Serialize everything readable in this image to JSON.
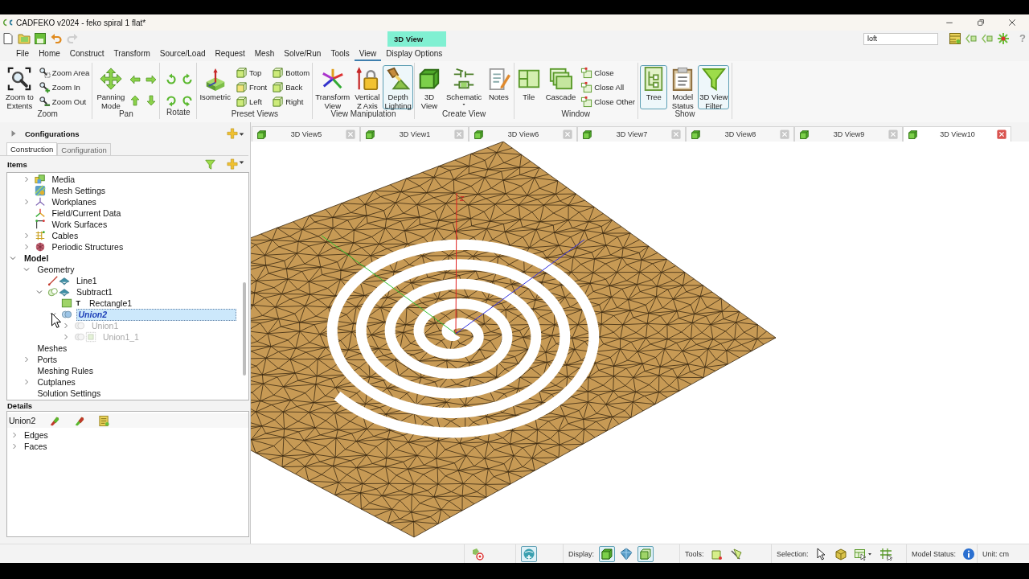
{
  "window": {
    "title": "CADFEKO v2024 - feko spiral 1 flat*",
    "context_tab": "3D View",
    "search": {
      "value": "loft"
    },
    "help": "?"
  },
  "quick_access": [
    {
      "disabled": false
    },
    {
      "disabled": false
    },
    {
      "disabled": false
    },
    {
      "disabled": false
    },
    {
      "disabled": true
    }
  ],
  "menu_tabs": [
    {
      "label": "File",
      "selected": false
    },
    {
      "label": "Home",
      "selected": false
    },
    {
      "label": "Construct",
      "selected": false
    },
    {
      "label": "Transform",
      "selected": false
    },
    {
      "label": "Source/Load",
      "selected": false
    },
    {
      "label": "Request",
      "selected": false
    },
    {
      "label": "Mesh",
      "selected": false
    },
    {
      "label": "Solve/Run",
      "selected": false
    },
    {
      "label": "Tools",
      "selected": false
    },
    {
      "label": "View",
      "selected": true
    },
    {
      "label": "Display Options",
      "selected": false
    }
  ],
  "ribbon": [
    {
      "label": "Zoom",
      "items": [
        {
          "kind": "large",
          "label": "Zoom to\nExtents",
          "on": false
        },
        {
          "kind": "small",
          "label": "Zoom Area",
          "on": false
        },
        {
          "kind": "small",
          "label": "Zoom In",
          "on": false
        },
        {
          "kind": "small",
          "label": "Zoom Out",
          "on": false
        }
      ]
    },
    {
      "label": "Pan",
      "items": [
        {
          "kind": "large",
          "label": "Panning\nMode",
          "on": false
        },
        {
          "kind": "icon",
          "on": false
        },
        {
          "kind": "icon",
          "on": false
        },
        {
          "kind": "icon",
          "on": false
        },
        {
          "kind": "icon",
          "on": false
        }
      ]
    },
    {
      "label": "Rotate",
      "items": [
        {
          "kind": "icon",
          "on": false
        },
        {
          "kind": "icon",
          "on": false
        },
        {
          "kind": "icon",
          "on": false
        },
        {
          "kind": "icon",
          "on": false
        }
      ]
    },
    {
      "label": "Preset Views",
      "items": [
        {
          "kind": "large",
          "label": "Isometric",
          "on": false
        },
        {
          "kind": "small",
          "label": "Top",
          "on": false
        },
        {
          "kind": "small",
          "label": "Front",
          "on": false
        },
        {
          "kind": "small",
          "label": "Left",
          "on": false
        },
        {
          "kind": "small",
          "label": "Bottom",
          "on": false
        },
        {
          "kind": "small",
          "label": "Back",
          "on": false
        },
        {
          "kind": "small",
          "label": "Right",
          "on": false
        }
      ]
    },
    {
      "label": "View Manipulation",
      "items": [
        {
          "kind": "large",
          "label": "Transform\nView",
          "on": false
        },
        {
          "kind": "large",
          "label": "Vertical\nZ Axis",
          "on": false
        },
        {
          "kind": "large",
          "label": "Depth\nLighting",
          "on": true
        }
      ]
    },
    {
      "label": "Create View",
      "items": [
        {
          "kind": "large",
          "label": "3D\nView",
          "on": false
        },
        {
          "kind": "split",
          "label": "Schematic",
          "on": false
        },
        {
          "kind": "large",
          "label": "Notes",
          "on": false
        }
      ]
    },
    {
      "label": "Window",
      "items": [
        {
          "kind": "large",
          "label": "Tile",
          "on": false
        },
        {
          "kind": "large",
          "label": "Cascade",
          "on": false
        },
        {
          "kind": "small",
          "label": "Close",
          "on": false
        },
        {
          "kind": "small",
          "label": "Close All",
          "on": false
        },
        {
          "kind": "small",
          "label": "Close Other",
          "on": false
        }
      ]
    },
    {
      "label": "Show",
      "items": [
        {
          "kind": "large",
          "label": "Tree",
          "on": true
        },
        {
          "kind": "large",
          "label": "Model\nStatus",
          "on": false
        },
        {
          "kind": "large",
          "label": "3D View\nFilter",
          "on": true
        }
      ]
    }
  ],
  "configurations": {
    "label": "Configurations",
    "expanded": false
  },
  "panel_tabs": [
    {
      "label": "Construction",
      "selected": true
    },
    {
      "label": "Configuration",
      "selected": false
    }
  ],
  "items_header": "Items",
  "tree": {
    "partial_branch": [
      {
        "label": "Media",
        "kind": "media",
        "expanded": false,
        "selected": false,
        "disabled": false
      },
      {
        "label": "Mesh Settings",
        "kind": "mesh-settings",
        "selected": false,
        "disabled": false
      },
      {
        "label": "Workplanes",
        "kind": "workplanes",
        "expanded": false,
        "selected": false,
        "disabled": false
      },
      {
        "label": "Field/Current Data",
        "kind": "field-data",
        "selected": false,
        "disabled": false
      },
      {
        "label": "Work Surfaces",
        "kind": "work-surfaces",
        "selected": false,
        "disabled": false
      },
      {
        "label": "Cables",
        "kind": "cables",
        "expanded": false,
        "selected": false,
        "disabled": false
      },
      {
        "label": "Periodic Structures",
        "kind": "periodic",
        "expanded": false,
        "selected": false,
        "disabled": false
      }
    ],
    "roots": [
      {
        "label": "Model",
        "kind": "root",
        "expanded": true,
        "selected": false,
        "disabled": false,
        "children": [
          {
            "label": "Geometry",
            "expanded": true,
            "selected": false,
            "disabled": false,
            "children": [
              {
                "label": "Line1",
                "kind": "line",
                "selected": false,
                "disabled": false
              },
              {
                "label": "Subtract1",
                "kind": "subtract",
                "expanded": true,
                "selected": false,
                "disabled": false,
                "children": [
                  {
                    "label": "Rectangle1",
                    "kind": "rectangle",
                    "tag": "T",
                    "selected": false,
                    "disabled": false
                  },
                  {
                    "label": "Union2",
                    "kind": "union",
                    "expanded": true,
                    "selected": true,
                    "disabled": false,
                    "children": [
                      {
                        "label": "Union1",
                        "kind": "union",
                        "expanded": false,
                        "selected": false,
                        "disabled": true
                      },
                      {
                        "label": "Union1_1",
                        "kind": "union-face",
                        "expanded": false,
                        "selected": false,
                        "disabled": true
                      }
                    ]
                  }
                ]
              }
            ]
          },
          {
            "label": "Meshes",
            "selected": false,
            "disabled": false
          },
          {
            "label": "Ports",
            "expanded": false,
            "selected": false,
            "disabled": false
          },
          {
            "label": "Meshing Rules",
            "selected": false,
            "disabled": false
          },
          {
            "label": "Cutplanes",
            "expanded": false,
            "selected": false,
            "disabled": false
          },
          {
            "label": "Solution Settings",
            "selected": false,
            "disabled": false
          }
        ]
      }
    ]
  },
  "details": {
    "title": "Details",
    "object": "Union2",
    "rows": [
      {
        "label": "Edges",
        "expanded": false
      },
      {
        "label": "Faces",
        "expanded": false
      }
    ]
  },
  "doc_tabs": [
    {
      "label": "3D View5",
      "selected": false
    },
    {
      "label": "3D View1",
      "selected": false
    },
    {
      "label": "3D View6",
      "selected": false
    },
    {
      "label": "3D View7",
      "selected": false
    },
    {
      "label": "3D View8",
      "selected": false
    },
    {
      "label": "3D View9",
      "selected": false
    },
    {
      "label": "3D View10",
      "selected": true
    }
  ],
  "viewport": {
    "axis_label": "Z"
  },
  "status_bar": {
    "sections": [
      {
        "buttons": [
          {
            "on": false
          }
        ]
      },
      {
        "buttons": [
          {
            "on": true
          }
        ]
      },
      {
        "label": "Display:",
        "buttons": [
          {
            "on": true
          },
          {
            "on": false
          },
          {
            "on": true
          }
        ]
      },
      {
        "label": "Tools:",
        "buttons": [
          {
            "on": false
          },
          {
            "on": false
          }
        ]
      },
      {
        "label": "Selection:",
        "buttons": [
          {
            "on": false
          },
          {
            "on": false
          },
          {
            "on": false
          },
          {
            "on": false
          }
        ]
      },
      {
        "label": "Model Status:",
        "buttons": [
          {
            "on": false
          }
        ]
      },
      {
        "label": "Unit: cm"
      }
    ]
  }
}
